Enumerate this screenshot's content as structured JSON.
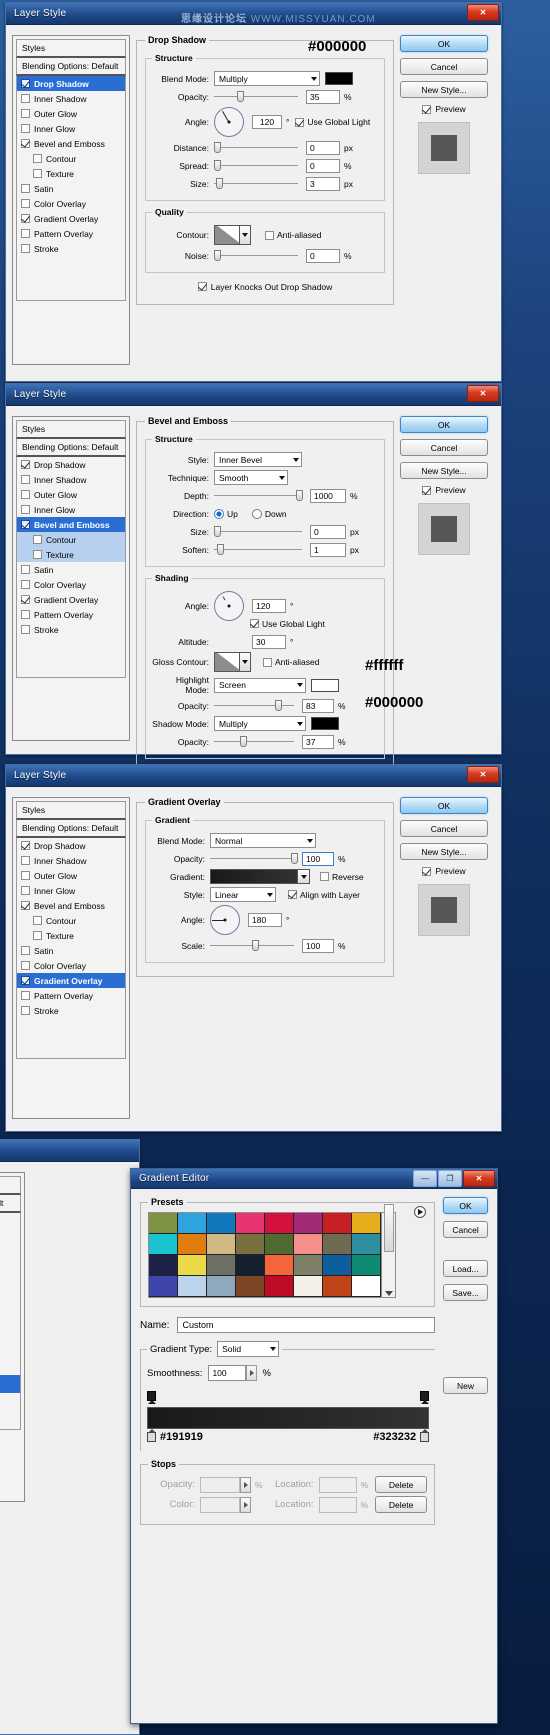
{
  "watermark": {
    "cn": "思缘设计论坛",
    "url": "WWW.MISSYUAN.COM"
  },
  "window_title": "Layer Style",
  "gradient_editor_title": "Gradient Editor",
  "titlebar_glyphs": {
    "minimize": "—",
    "maximize": "❐",
    "close": "✕"
  },
  "buttons": {
    "ok": "OK",
    "cancel": "Cancel",
    "new_style": "New Style...",
    "preview": "Preview",
    "load": "Load...",
    "save": "Save...",
    "new": "New",
    "delete": "Delete"
  },
  "styles_list": {
    "header": "Styles",
    "blending_options": "Blending Options: Default",
    "items": [
      {
        "label": "Drop Shadow",
        "checked": true,
        "indent": false
      },
      {
        "label": "Inner Shadow",
        "checked": false,
        "indent": false
      },
      {
        "label": "Outer Glow",
        "checked": false,
        "indent": false
      },
      {
        "label": "Inner Glow",
        "checked": false,
        "indent": false
      },
      {
        "label": "Bevel and Emboss",
        "checked": true,
        "indent": false
      },
      {
        "label": "Contour",
        "checked": false,
        "indent": true
      },
      {
        "label": "Texture",
        "checked": false,
        "indent": true
      },
      {
        "label": "Satin",
        "checked": false,
        "indent": false
      },
      {
        "label": "Color Overlay",
        "checked": false,
        "indent": false
      },
      {
        "label": "Gradient Overlay",
        "checked": true,
        "indent": false
      },
      {
        "label": "Pattern Overlay",
        "checked": false,
        "indent": false
      },
      {
        "label": "Stroke",
        "checked": false,
        "indent": false
      }
    ]
  },
  "panel1": {
    "selected_style": "Drop Shadow",
    "group_title": "Drop Shadow",
    "structure_title": "Structure",
    "hex_note": "#000000",
    "labels": {
      "blend_mode": "Blend Mode:",
      "opacity": "Opacity:",
      "angle": "Angle:",
      "use_global_light": "Use Global Light",
      "distance": "Distance:",
      "spread": "Spread:",
      "size": "Size:",
      "quality": "Quality",
      "contour": "Contour:",
      "anti_aliased": "Anti-aliased",
      "noise": "Noise:",
      "knocks_out": "Layer Knocks Out Drop Shadow"
    },
    "values": {
      "blend_mode": "Multiply",
      "color": "#000000",
      "opacity": "35",
      "angle": "120",
      "angle_unit": "°",
      "use_global_light": true,
      "distance": "0",
      "spread": "0",
      "size": "3",
      "anti_aliased": false,
      "noise": "0",
      "knocks_out": true
    },
    "units": {
      "pct": "%",
      "px": "px"
    }
  },
  "panel2": {
    "selected_style": "Bevel and Emboss",
    "group_title": "Bevel and Emboss",
    "structure_title": "Structure",
    "shading_title": "Shading",
    "hex_highlight": "#ffffff",
    "hex_shadow": "#000000",
    "labels": {
      "style": "Style:",
      "technique": "Technique:",
      "depth": "Depth:",
      "direction": "Direction:",
      "up": "Up",
      "down": "Down",
      "size": "Size:",
      "soften": "Soften:",
      "angle": "Angle:",
      "use_global_light": "Use Global Light",
      "altitude": "Altitude:",
      "gloss_contour": "Gloss Contour:",
      "anti_aliased": "Anti-aliased",
      "highlight_mode": "Highlight Mode:",
      "opacity": "Opacity:",
      "shadow_mode": "Shadow Mode:"
    },
    "values": {
      "style": "Inner Bevel",
      "technique": "Smooth",
      "depth": "1000",
      "direction": "Up",
      "size": "0",
      "soften": "1",
      "angle": "120",
      "use_global_light": true,
      "altitude": "30",
      "anti_aliased": false,
      "highlight_mode": "Screen",
      "highlight_color": "#ffffff",
      "highlight_opacity": "83",
      "shadow_mode": "Multiply",
      "shadow_color": "#000000",
      "shadow_opacity": "37"
    },
    "units": {
      "pct": "%",
      "px": "px",
      "deg": "°"
    }
  },
  "panel3": {
    "selected_style": "Gradient Overlay",
    "group_title": "Gradient Overlay",
    "gradient_title": "Gradient",
    "labels": {
      "blend_mode": "Blend Mode:",
      "opacity": "Opacity:",
      "gradient": "Gradient:",
      "reverse": "Reverse",
      "style": "Style:",
      "align_with_layer": "Align with Layer",
      "angle": "Angle:",
      "scale": "Scale:"
    },
    "values": {
      "blend_mode": "Normal",
      "opacity": "100",
      "gradient_from": "#191919",
      "gradient_to": "#323232",
      "reverse": false,
      "style": "Linear",
      "align_with_layer": true,
      "angle": "180",
      "scale": "100"
    },
    "units": {
      "pct": "%",
      "deg": "°"
    }
  },
  "gradient_editor": {
    "presets_title": "Presets",
    "name_label": "Name:",
    "name_value": "Custom",
    "gradient_type_label": "Gradient Type:",
    "gradient_type_value": "Solid",
    "smoothness_label": "Smoothness:",
    "smoothness_value": "100",
    "stops_title": "Stops",
    "opacity_label": "Opacity:",
    "location_label": "Location:",
    "color_label": "Color:",
    "opacity_value": "",
    "location_value": "",
    "pct": "%",
    "stop_left_hex": "#191919",
    "stop_right_hex": "#323232",
    "preset_colors": [
      "#7f9442",
      "#2ea3dd",
      "#1278be",
      "#e6356f",
      "#d3113e",
      "#a32a77",
      "#c62024",
      "#e8ad1c",
      "#19c3d0",
      "#e07c10",
      "#cfba84",
      "#7a6f3f",
      "#4e6b32",
      "#f58f8a",
      "#6f6b52",
      "#2d8fa0",
      "#1e2148",
      "#ecd94a",
      "#6e7066",
      "#14202e",
      "#f4663a",
      "#7e8068",
      "#0e5e9e",
      "#0f8a74",
      "#4045ab",
      "#bbd4ea",
      "#8fa8bb",
      "#7b4526",
      "#c00b24",
      "#f3f0ea",
      "#c0441a",
      "#ffffff"
    ]
  }
}
